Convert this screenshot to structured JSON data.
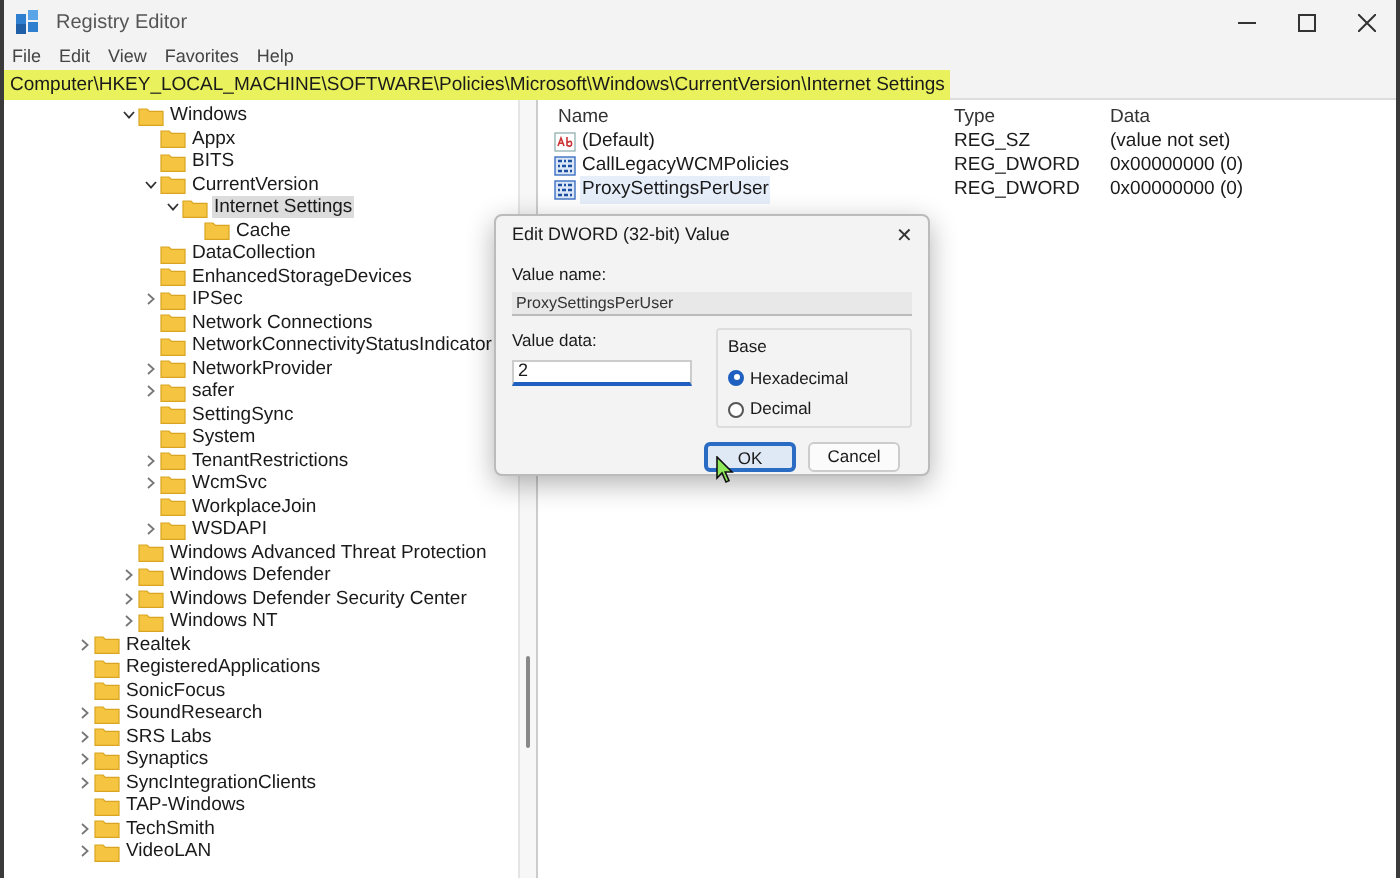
{
  "window": {
    "title": "Registry Editor"
  },
  "menu": [
    "File",
    "Edit",
    "View",
    "Favorites",
    "Help"
  ],
  "address": "Computer\\HKEY_LOCAL_MACHINE\\SOFTWARE\\Policies\\Microsoft\\Windows\\CurrentVersion\\Internet Settings",
  "tree": {
    "items": [
      {
        "children": [
          {
            "children": [
              {
                "label": "Windows",
                "expanded": true,
                "selected": false,
                "children": [
                  {
                    "label": "Appx",
                    "selected": false
                  },
                  {
                    "label": "BITS",
                    "selected": false
                  },
                  {
                    "label": "CurrentVersion",
                    "expanded": true,
                    "selected": false,
                    "children": [
                      {
                        "label": "Internet Settings",
                        "expanded": true,
                        "selected": true,
                        "children": [
                          {
                            "label": "Cache",
                            "selected": false
                          }
                        ]
                      }
                    ]
                  },
                  {
                    "label": "DataCollection",
                    "selected": false
                  },
                  {
                    "label": "EnhancedStorageDevices",
                    "selected": false
                  },
                  {
                    "label": "IPSec",
                    "expanded": false,
                    "selected": false
                  },
                  {
                    "label": "Network Connections",
                    "selected": false
                  },
                  {
                    "label": "NetworkConnectivityStatusIndicator",
                    "selected": false
                  },
                  {
                    "label": "NetworkProvider",
                    "expanded": false,
                    "selected": false
                  },
                  {
                    "label": "safer",
                    "expanded": false,
                    "selected": false
                  },
                  {
                    "label": "SettingSync",
                    "selected": false
                  },
                  {
                    "label": "System",
                    "selected": false
                  },
                  {
                    "label": "TenantRestrictions",
                    "expanded": false,
                    "selected": false
                  },
                  {
                    "label": "WcmSvc",
                    "expanded": false,
                    "selected": false
                  },
                  {
                    "label": "WorkplaceJoin",
                    "selected": false
                  },
                  {
                    "label": "WSDAPI",
                    "expanded": false,
                    "selected": false
                  }
                ]
              },
              {
                "label": "Windows Advanced Threat Protection",
                "selected": false
              },
              {
                "label": "Windows Defender",
                "expanded": false,
                "selected": false
              },
              {
                "label": "Windows Defender Security Center",
                "expanded": false,
                "selected": false
              },
              {
                "label": "Windows NT",
                "expanded": false,
                "selected": false
              }
            ]
          }
        ]
      },
      {
        "label": "Realtek",
        "expanded": false,
        "selected": false
      },
      {
        "label": "RegisteredApplications",
        "selected": false
      },
      {
        "label": "SonicFocus",
        "selected": false
      },
      {
        "label": "SoundResearch",
        "expanded": false,
        "selected": false
      },
      {
        "label": "SRS Labs",
        "expanded": false,
        "selected": false
      },
      {
        "label": "Synaptics",
        "expanded": false,
        "selected": false
      },
      {
        "label": "SyncIntegrationClients",
        "expanded": false,
        "selected": false
      },
      {
        "label": "TAP-Windows",
        "selected": false
      },
      {
        "label": "TechSmith",
        "expanded": false,
        "selected": false
      },
      {
        "label": "VideoLAN",
        "expanded": false,
        "selected": false
      }
    ]
  },
  "values": {
    "columns": [
      "Name",
      "Type",
      "Data"
    ],
    "rows": [
      {
        "kind": "string",
        "name": "(Default)",
        "type": "REG_SZ",
        "data": "(value not set)",
        "selected": false
      },
      {
        "kind": "dword",
        "name": "CallLegacyWCMPolicies",
        "type": "REG_DWORD",
        "data": "0x00000000 (0)",
        "selected": false
      },
      {
        "kind": "dword",
        "name": "ProxySettingsPerUser",
        "type": "REG_DWORD",
        "data": "0x00000000 (0)",
        "selected": true
      }
    ]
  },
  "dialog": {
    "title": "Edit DWORD (32-bit) Value",
    "close": "✕",
    "value_name_label": "Value name:",
    "value_name": "ProxySettingsPerUser",
    "value_data_label": "Value data:",
    "value_data": "2",
    "base_label": "Base",
    "base_options": [
      {
        "label": "Hexadecimal",
        "selected": true
      },
      {
        "label": "Decimal",
        "selected": false
      }
    ],
    "buttons": [
      {
        "label": "OK",
        "focused": true
      },
      {
        "label": "Cancel",
        "focused": false
      }
    ]
  }
}
